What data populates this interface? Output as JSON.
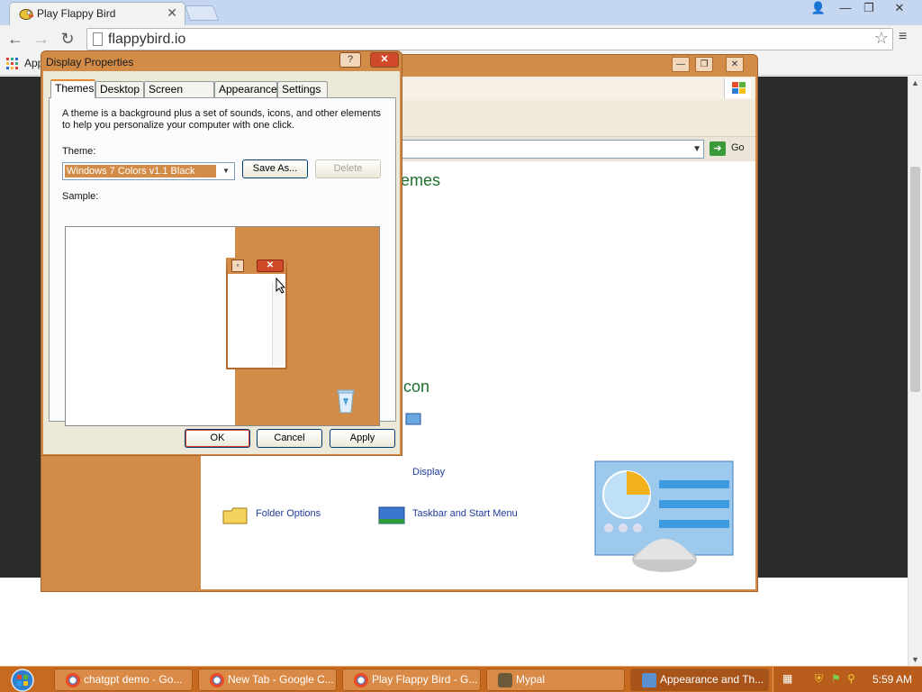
{
  "browser": {
    "tab_title": "Play Flappy Bird",
    "url": "flappybird.io",
    "bookmarks_label": "Apps",
    "controls": {
      "back": "←",
      "forward": "→",
      "reload": "↻",
      "star": "☆",
      "menu": "≡",
      "tab_close": "✕"
    },
    "window_controls": {
      "user": "👤",
      "minimize": "—",
      "restore": "❐",
      "close": "✕"
    }
  },
  "control_panel": {
    "heading_themes": "emes",
    "heading_icon": "con",
    "links": {
      "display": "Display",
      "folder_options": "Folder Options",
      "taskbar_start_menu": "Taskbar and Start Menu"
    },
    "go_label": "Go",
    "buttons": {
      "minimize": "—",
      "restore": "❐",
      "close": "✕"
    }
  },
  "dialog": {
    "title": "Display Properties",
    "help": "?",
    "close": "✕",
    "tabs": [
      "Themes",
      "Desktop",
      "Screen Saver",
      "Appearance",
      "Settings"
    ],
    "description": "A theme is a background plus a set of sounds, icons, and other elements to help you personalize your computer with one click.",
    "theme_label": "Theme:",
    "theme_value": "Windows 7 Colors v1.1 Black",
    "save_as": "Save As...",
    "delete": "Delete",
    "sample_label": "Sample:",
    "ok": "OK",
    "cancel": "Cancel",
    "apply": "Apply"
  },
  "taskbar": {
    "items": [
      "chatgpt demo - Go...",
      "New Tab - Google C...",
      "Play Flappy Bird - G...",
      "Mypal",
      "Appearance and Th..."
    ],
    "clock": "5:59 AM"
  },
  "colors": {
    "theme_orange": "#d28c48",
    "taskbar": "#c7691f",
    "link_blue": "#1f3b9b",
    "heading_green": "#1e6e2d"
  }
}
